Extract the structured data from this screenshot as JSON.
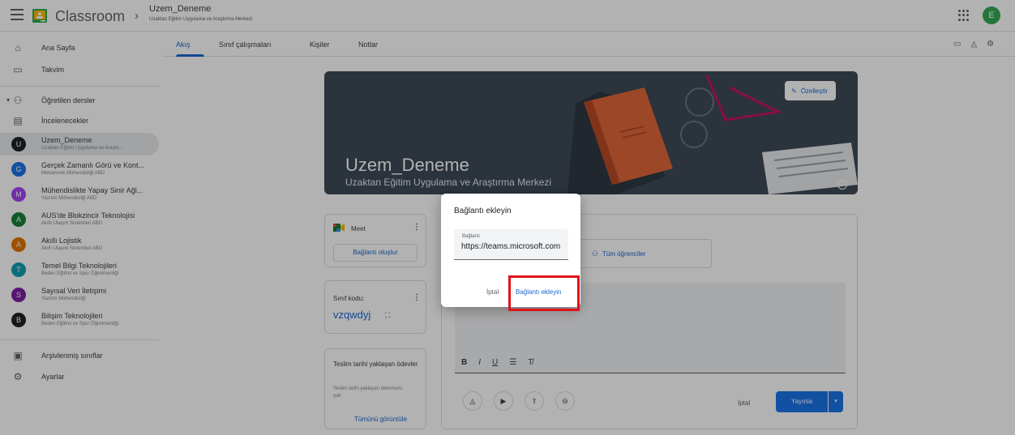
{
  "header": {
    "brand": "Classroom",
    "course_title": "Uzem_Deneme",
    "course_subtitle": "Uzaktan Eğitim Uygulama ve Araştırma Merkezi",
    "user_initial": "E"
  },
  "sidebar": {
    "items": [
      {
        "label": "Ana Sayfa"
      },
      {
        "label": "Takvim"
      },
      {
        "label": "Öğretilen dersler"
      },
      {
        "label": "İncelenecekler"
      }
    ],
    "courses": [
      {
        "initial": "U",
        "name": "Uzem_Deneme",
        "sub": "Uzaktan Eğitim Uygulama ve Araştır...",
        "color": "#202124"
      },
      {
        "initial": "G",
        "name": "Gerçek Zamanlı Görü ve Kont...",
        "sub": "Mekatronik Mühendisliği ABD",
        "color": "#1a73e8"
      },
      {
        "initial": "M",
        "name": "Mühendislikte Yapay Sinir Ağl...",
        "sub": "Yazılım Mühendisliği ABD",
        "color": "#a142f4"
      },
      {
        "initial": "A",
        "name": "AUS'de Blokzincir Teknolojisi",
        "sub": "Akıllı Ulaşım Sistemleri ABD",
        "color": "#188038"
      },
      {
        "initial": "A",
        "name": "Akıllı Lojistik",
        "sub": "Akıllı Ulaşım Sistemleri ABD",
        "color": "#e37400"
      },
      {
        "initial": "T",
        "name": "Temel Bilgi Teknolojileri",
        "sub": "Beden Eğitimi ve Spor Öğretmenliği",
        "color": "#129eaf"
      },
      {
        "initial": "S",
        "name": "Sayısal Veri İletişimi",
        "sub": "Yazılım Mühendisliği",
        "color": "#7b1fa2"
      },
      {
        "initial": "B",
        "name": "Bilişim Teknolojileri",
        "sub": "Beden Eğitimi ve Spor Öğretmenliği",
        "color": "#202124"
      }
    ],
    "bottom_items": [
      {
        "label": "Arşivlenmiş sınıflar"
      },
      {
        "label": "Ayarlar"
      }
    ]
  },
  "tabs": [
    {
      "label": "Akış"
    },
    {
      "label": "Sınıf çalışmaları"
    },
    {
      "label": "Kişiler"
    },
    {
      "label": "Notlar"
    }
  ],
  "banner": {
    "title": "Uzem_Deneme",
    "subtitle": "Uzaktan Eğitim Uygulama ve Araştırma Merkezi",
    "customize_label": "Özelleştir"
  },
  "meet": {
    "title": "Meet",
    "button": "Bağlantı oluştur"
  },
  "class_code": {
    "label": "Sınıf kodu:",
    "value": "vzqwdyj"
  },
  "due": {
    "title": "Teslim tarihi yaklaşan ödevler",
    "empty": "Teslim tarihi yaklaşan ödev/soru yok",
    "link": "Tümünü görüntüle"
  },
  "post": {
    "audience": "Tüm öğrenciler",
    "cancel": "İptal",
    "publish": "Yayınla"
  },
  "dialog": {
    "title": "Bağlantı ekleyin",
    "field_label": "Bağlantı",
    "field_value": "https://teams.microsoft.com",
    "cancel": "İptal",
    "confirm": "Bağlantı ekleyin"
  },
  "colors": {
    "accent": "#1967d2",
    "publish": "#1a73e8",
    "highlight": "#e0121a"
  }
}
